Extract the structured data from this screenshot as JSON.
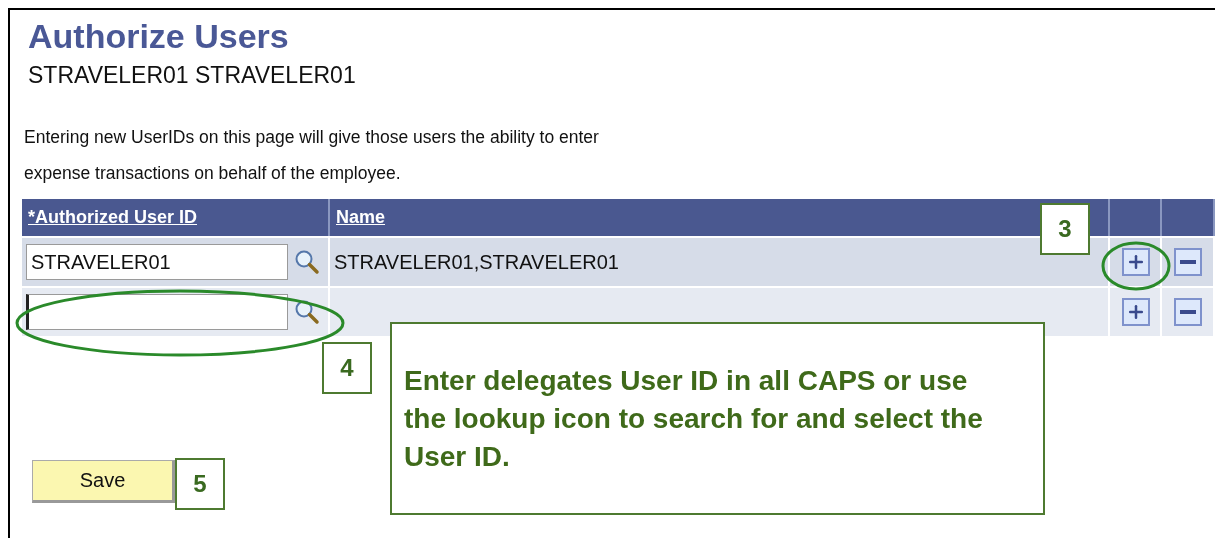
{
  "page": {
    "title": "Authorize Users",
    "subtitle": "STRAVELER01 STRAVELER01",
    "description": "Entering new UserIDs on this page will give those users the ability to enter expense transactions on behalf of the employee."
  },
  "table": {
    "columns": [
      "*Authorized User ID",
      "Name"
    ],
    "rows": [
      {
        "user_id": "STRAVELER01",
        "name": "STRAVELER01,STRAVELER01",
        "focused": false
      },
      {
        "focused": true
      }
    ]
  },
  "save_button": "Save",
  "annotations": [
    {
      "kind": "number",
      "text": "3"
    },
    {
      "kind": "number",
      "text": "4"
    },
    {
      "kind": "callout",
      "text": "Enter delegates User ID in all CAPS or use the lookup icon to search for and select the User ID."
    },
    {
      "kind": "number",
      "text": "5"
    }
  ]
}
